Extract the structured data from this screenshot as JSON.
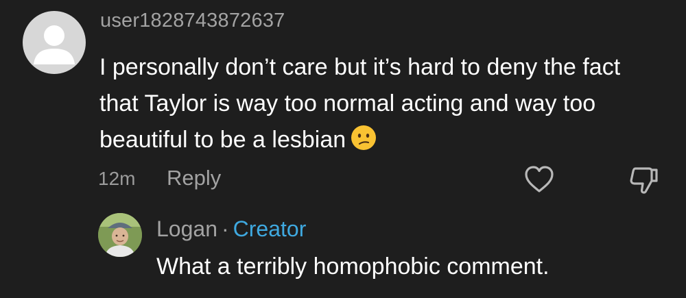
{
  "comment": {
    "username": "user1828743872637",
    "text": "I personally don’t care but it’s hard to deny the fact that Taylor is way too normal acting and way too beautiful to be a lesbian",
    "emoji": "confused-face-emoji",
    "time": "12m",
    "reply_label": "Reply",
    "like_icon": "heart-icon",
    "dislike_icon": "thumbs-down-icon"
  },
  "reply": {
    "author": "Logan",
    "separator": "·",
    "badge": "Creator",
    "text": "What a terribly homophobic comment."
  },
  "colors": {
    "background": "#1e1e1e",
    "muted_text": "#a3a3a3",
    "creator_badge": "#3fa9e0"
  }
}
